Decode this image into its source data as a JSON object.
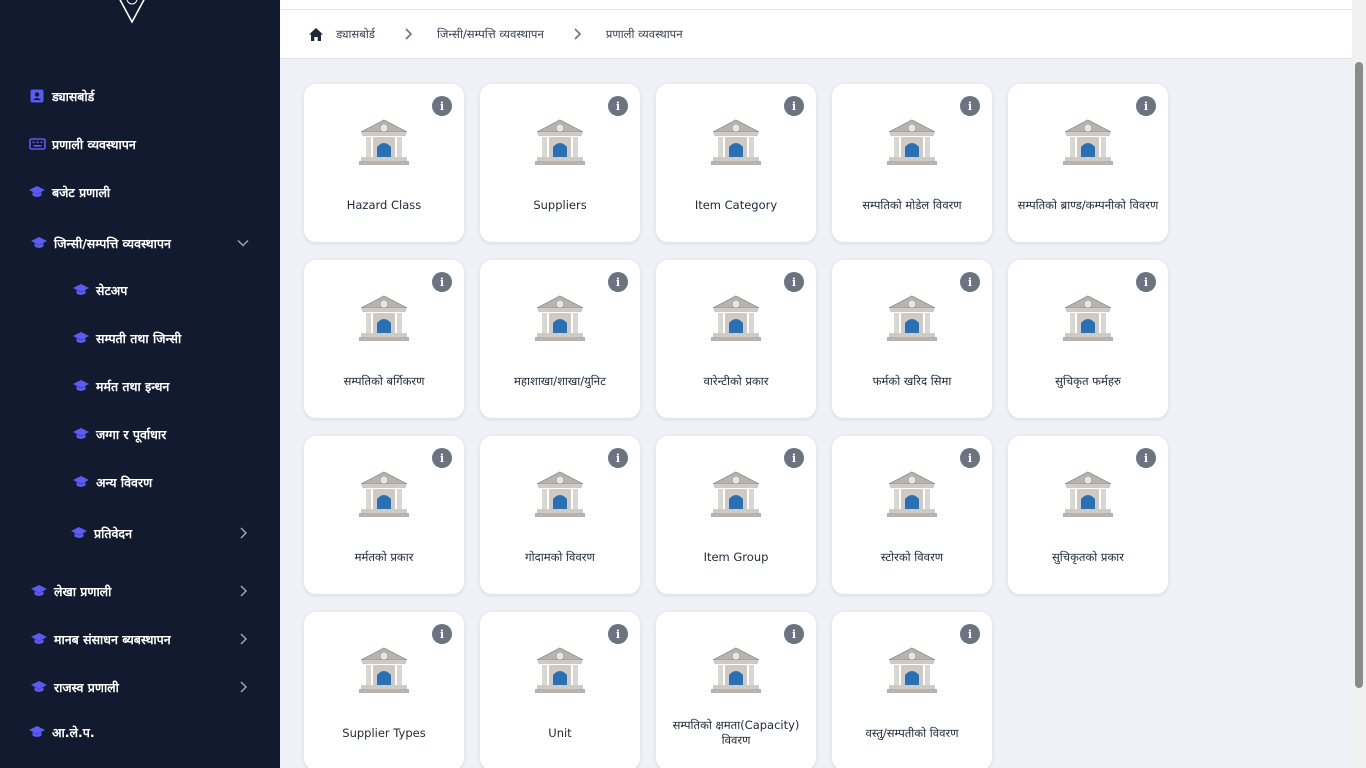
{
  "sidebar": {
    "items": [
      {
        "label": "ड्यासबोर्ड",
        "icon": "id-badge-icon"
      },
      {
        "label": "प्रणाली व्यवस्थापन",
        "icon": "keyboard-icon"
      },
      {
        "label": "बजेट प्रणाली",
        "icon": "graduation-cap-icon"
      },
      {
        "label": "जिन्सी/सम्पत्ति व्यवस्थापन",
        "icon": "graduation-cap-icon",
        "expanded": true
      },
      {
        "label": "सेटअप",
        "icon": "graduation-cap-icon"
      },
      {
        "label": "सम्पती तथा जिन्सी",
        "icon": "graduation-cap-icon"
      },
      {
        "label": "मर्मत तथा इन्धन",
        "icon": "graduation-cap-icon"
      },
      {
        "label": "जग्गा र पूर्वाधार",
        "icon": "graduation-cap-icon"
      },
      {
        "label": "अन्य विवरण",
        "icon": "graduation-cap-icon"
      },
      {
        "label": "प्रतिवेदन",
        "icon": "graduation-cap-icon"
      },
      {
        "label": "लेखा प्रणाली",
        "icon": "graduation-cap-icon"
      },
      {
        "label": "मानब संसाधन ब्यबस्थापन",
        "icon": "graduation-cap-icon"
      },
      {
        "label": "राजस्व प्रणाली",
        "icon": "graduation-cap-icon"
      },
      {
        "label": "आ.ले.प.",
        "icon": "graduation-cap-icon"
      }
    ]
  },
  "breadcrumb": {
    "home_icon": "home-icon",
    "items": [
      "ड्यासबोर्ड",
      "जिन्सी/सम्पत्ति व्यवस्थापन",
      "प्रणाली व्यवस्थापन"
    ]
  },
  "cards": [
    {
      "label": "Hazard Class"
    },
    {
      "label": "Suppliers"
    },
    {
      "label": "Item Category"
    },
    {
      "label": "सम्पतिको मोडेल विवरण"
    },
    {
      "label": "सम्पतिको ब्राण्ड/कम्पनीको विवरण"
    },
    {
      "label": "सम्पतिको बर्गिकरण"
    },
    {
      "label": "महाशाखा/शाखा/युनिट"
    },
    {
      "label": "वारेन्टीको प्रकार"
    },
    {
      "label": "फर्मको खरिद सिमा"
    },
    {
      "label": "सुचिकृत फर्महरु"
    },
    {
      "label": "मर्मतको प्रकार"
    },
    {
      "label": "गोदामको विवरण"
    },
    {
      "label": "Item Group"
    },
    {
      "label": "स्टोरको विवरण"
    },
    {
      "label": "सुचिकृतको प्रकार"
    },
    {
      "label": "Supplier Types"
    },
    {
      "label": "Unit"
    },
    {
      "label": "सम्पतिको क्षमता(Capacity) विवरण"
    },
    {
      "label": "वस्तु/सम्पतीको विवरण"
    }
  ],
  "card_info_glyph": "i",
  "card_icon": "bank-icon",
  "colors": {
    "sidebar_bg": "#111a2e",
    "accent": "#5b5bf0",
    "main_bg": "#eef1f6"
  }
}
